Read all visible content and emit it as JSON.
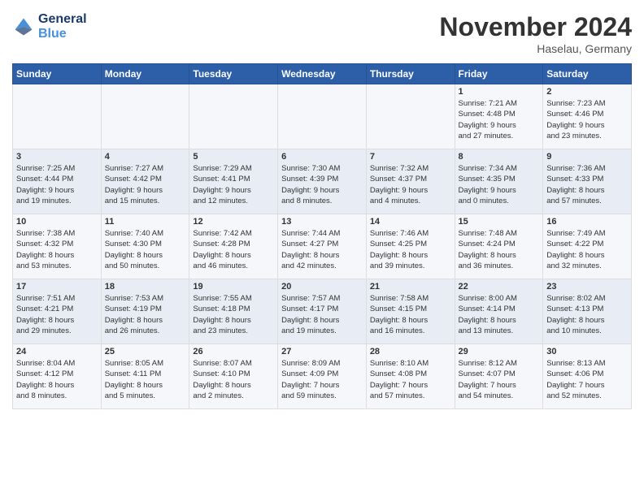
{
  "header": {
    "logo_line1": "General",
    "logo_line2": "Blue",
    "month_title": "November 2024",
    "location": "Haselau, Germany"
  },
  "weekdays": [
    "Sunday",
    "Monday",
    "Tuesday",
    "Wednesday",
    "Thursday",
    "Friday",
    "Saturday"
  ],
  "weeks": [
    [
      {
        "day": "",
        "info": ""
      },
      {
        "day": "",
        "info": ""
      },
      {
        "day": "",
        "info": ""
      },
      {
        "day": "",
        "info": ""
      },
      {
        "day": "",
        "info": ""
      },
      {
        "day": "1",
        "info": "Sunrise: 7:21 AM\nSunset: 4:48 PM\nDaylight: 9 hours\nand 27 minutes."
      },
      {
        "day": "2",
        "info": "Sunrise: 7:23 AM\nSunset: 4:46 PM\nDaylight: 9 hours\nand 23 minutes."
      }
    ],
    [
      {
        "day": "3",
        "info": "Sunrise: 7:25 AM\nSunset: 4:44 PM\nDaylight: 9 hours\nand 19 minutes."
      },
      {
        "day": "4",
        "info": "Sunrise: 7:27 AM\nSunset: 4:42 PM\nDaylight: 9 hours\nand 15 minutes."
      },
      {
        "day": "5",
        "info": "Sunrise: 7:29 AM\nSunset: 4:41 PM\nDaylight: 9 hours\nand 12 minutes."
      },
      {
        "day": "6",
        "info": "Sunrise: 7:30 AM\nSunset: 4:39 PM\nDaylight: 9 hours\nand 8 minutes."
      },
      {
        "day": "7",
        "info": "Sunrise: 7:32 AM\nSunset: 4:37 PM\nDaylight: 9 hours\nand 4 minutes."
      },
      {
        "day": "8",
        "info": "Sunrise: 7:34 AM\nSunset: 4:35 PM\nDaylight: 9 hours\nand 0 minutes."
      },
      {
        "day": "9",
        "info": "Sunrise: 7:36 AM\nSunset: 4:33 PM\nDaylight: 8 hours\nand 57 minutes."
      }
    ],
    [
      {
        "day": "10",
        "info": "Sunrise: 7:38 AM\nSunset: 4:32 PM\nDaylight: 8 hours\nand 53 minutes."
      },
      {
        "day": "11",
        "info": "Sunrise: 7:40 AM\nSunset: 4:30 PM\nDaylight: 8 hours\nand 50 minutes."
      },
      {
        "day": "12",
        "info": "Sunrise: 7:42 AM\nSunset: 4:28 PM\nDaylight: 8 hours\nand 46 minutes."
      },
      {
        "day": "13",
        "info": "Sunrise: 7:44 AM\nSunset: 4:27 PM\nDaylight: 8 hours\nand 42 minutes."
      },
      {
        "day": "14",
        "info": "Sunrise: 7:46 AM\nSunset: 4:25 PM\nDaylight: 8 hours\nand 39 minutes."
      },
      {
        "day": "15",
        "info": "Sunrise: 7:48 AM\nSunset: 4:24 PM\nDaylight: 8 hours\nand 36 minutes."
      },
      {
        "day": "16",
        "info": "Sunrise: 7:49 AM\nSunset: 4:22 PM\nDaylight: 8 hours\nand 32 minutes."
      }
    ],
    [
      {
        "day": "17",
        "info": "Sunrise: 7:51 AM\nSunset: 4:21 PM\nDaylight: 8 hours\nand 29 minutes."
      },
      {
        "day": "18",
        "info": "Sunrise: 7:53 AM\nSunset: 4:19 PM\nDaylight: 8 hours\nand 26 minutes."
      },
      {
        "day": "19",
        "info": "Sunrise: 7:55 AM\nSunset: 4:18 PM\nDaylight: 8 hours\nand 23 minutes."
      },
      {
        "day": "20",
        "info": "Sunrise: 7:57 AM\nSunset: 4:17 PM\nDaylight: 8 hours\nand 19 minutes."
      },
      {
        "day": "21",
        "info": "Sunrise: 7:58 AM\nSunset: 4:15 PM\nDaylight: 8 hours\nand 16 minutes."
      },
      {
        "day": "22",
        "info": "Sunrise: 8:00 AM\nSunset: 4:14 PM\nDaylight: 8 hours\nand 13 minutes."
      },
      {
        "day": "23",
        "info": "Sunrise: 8:02 AM\nSunset: 4:13 PM\nDaylight: 8 hours\nand 10 minutes."
      }
    ],
    [
      {
        "day": "24",
        "info": "Sunrise: 8:04 AM\nSunset: 4:12 PM\nDaylight: 8 hours\nand 8 minutes."
      },
      {
        "day": "25",
        "info": "Sunrise: 8:05 AM\nSunset: 4:11 PM\nDaylight: 8 hours\nand 5 minutes."
      },
      {
        "day": "26",
        "info": "Sunrise: 8:07 AM\nSunset: 4:10 PM\nDaylight: 8 hours\nand 2 minutes."
      },
      {
        "day": "27",
        "info": "Sunrise: 8:09 AM\nSunset: 4:09 PM\nDaylight: 7 hours\nand 59 minutes."
      },
      {
        "day": "28",
        "info": "Sunrise: 8:10 AM\nSunset: 4:08 PM\nDaylight: 7 hours\nand 57 minutes."
      },
      {
        "day": "29",
        "info": "Sunrise: 8:12 AM\nSunset: 4:07 PM\nDaylight: 7 hours\nand 54 minutes."
      },
      {
        "day": "30",
        "info": "Sunrise: 8:13 AM\nSunset: 4:06 PM\nDaylight: 7 hours\nand 52 minutes."
      }
    ]
  ]
}
